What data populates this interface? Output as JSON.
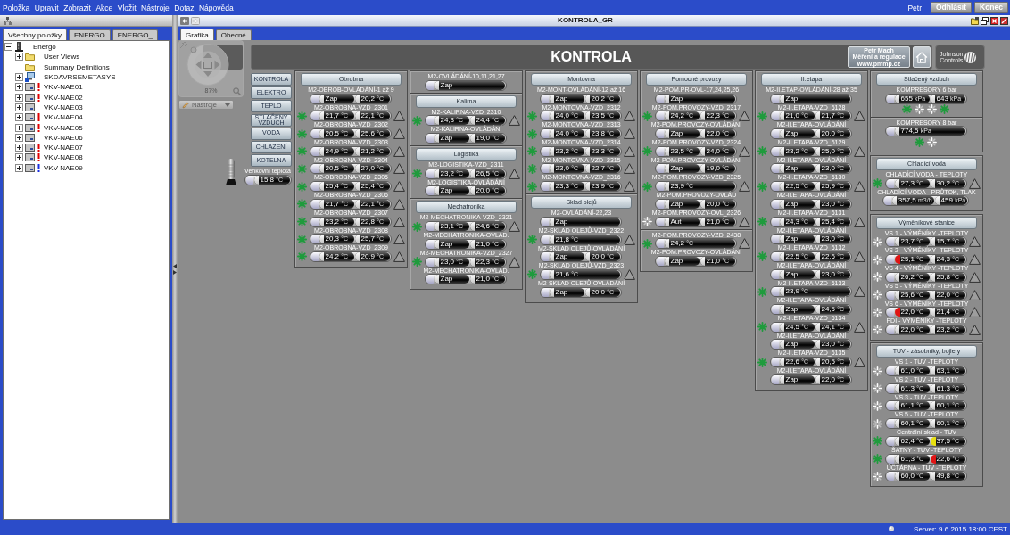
{
  "menu": [
    "Položka",
    "Upravit",
    "Zobrazit",
    "Akce",
    "Vložit",
    "Nástroje",
    "Dotaz",
    "Nápověda"
  ],
  "user": {
    "name": "Petr",
    "buttons": [
      "Odhlásit",
      "Konec"
    ]
  },
  "left_pane": {
    "tabs": [
      {
        "label": "Všechny položky",
        "selected": true
      },
      {
        "label": "ENERGO",
        "selected": false
      },
      {
        "label": "ENERGO_",
        "selected": false
      }
    ],
    "tree": [
      {
        "label": "Energo",
        "kind": "site",
        "expandable": true,
        "expanded": true,
        "alarm": false,
        "children": [
          {
            "label": "User Views",
            "kind": "folder",
            "expandable": true,
            "expanded": false,
            "alarm": false
          },
          {
            "label": "Summary Definitions",
            "kind": "folder",
            "expandable": false,
            "alarm": false
          },
          {
            "label": "SKDAVRSEMETASYS",
            "kind": "computer",
            "expandable": true,
            "expanded": false,
            "alarm": false
          },
          {
            "label": "VKV-NAE01",
            "kind": "controller",
            "expandable": true,
            "expanded": false,
            "alarm": true,
            "color": "#e00000"
          },
          {
            "label": "VKV-NAE02",
            "kind": "controller",
            "expandable": true,
            "expanded": false,
            "alarm": true,
            "color": "#e00000"
          },
          {
            "label": "VKV-NAE03",
            "kind": "controller",
            "expandable": true,
            "expanded": false,
            "alarm": false
          },
          {
            "label": "VKV-NAE04",
            "kind": "controller",
            "expandable": true,
            "expanded": false,
            "alarm": true,
            "color": "#e00000"
          },
          {
            "label": "VKV-NAE05",
            "kind": "controller",
            "expandable": true,
            "expanded": false,
            "alarm": true,
            "color": "#e00000"
          },
          {
            "label": "VKV-NAE06",
            "kind": "controller",
            "expandable": true,
            "expanded": false,
            "alarm": false
          },
          {
            "label": "VKV-NAE07",
            "kind": "controller",
            "expandable": true,
            "expanded": false,
            "alarm": true,
            "color": "#e00000"
          },
          {
            "label": "VKV-NAE08",
            "kind": "controller",
            "expandable": true,
            "expanded": false,
            "alarm": true,
            "color": "#e00000"
          },
          {
            "label": "VKV-NAE09",
            "kind": "controller",
            "expandable": true,
            "expanded": false,
            "alarm": true,
            "color": "#1a2ee0"
          }
        ]
      }
    ]
  },
  "window": {
    "title": "KONTROLA_GR",
    "tabs": [
      {
        "label": "Grafika",
        "selected": true
      },
      {
        "label": "Obecné",
        "selected": false
      }
    ]
  },
  "navigator": {
    "zoom": "87%",
    "tools": "Nástroje"
  },
  "banner": {
    "title": "KONTROLA",
    "company": [
      "Petr Mach",
      "Měření a regulace",
      "www.pmmp.cz"
    ],
    "logo": [
      "Johnson",
      "Controls"
    ]
  },
  "nav_buttons": [
    "KONTROLA",
    "ELEKTRO",
    "TEPLO",
    "STLAČENÝ VZDUCH",
    "VODA",
    "CHLAZENÍ",
    "KOTELNA"
  ],
  "outdoor": {
    "label": "Venkovní teplota",
    "values": [
      {
        "value": "15,8",
        "unit": "°C"
      }
    ]
  },
  "columns": [
    {
      "panels": [
        {
          "sections": [
            {
              "title": "Obrobna",
              "items": [
                {
                  "label": "M2-OBROB-OVLÁDÁNÍ-1 až 9",
                  "values": [
                    {
                      "value": "Zap"
                    },
                    {
                      "value": "20,2",
                      "unit": "°C"
                    }
                  ],
                  "warning": false
                },
                {
                  "label": "M2-OBROBNA-VZD_2301",
                  "fan": {
                    "running": true
                  },
                  "values": [
                    {
                      "value": "21,7",
                      "unit": "°C"
                    },
                    {
                      "value": "22,1",
                      "unit": "°C"
                    }
                  ],
                  "warning": true
                },
                {
                  "label": "M2-OBROBNA-VZD_2302",
                  "fan": {
                    "running": true
                  },
                  "values": [
                    {
                      "value": "20,5",
                      "unit": "°C"
                    },
                    {
                      "value": "25,6",
                      "unit": "°C"
                    }
                  ],
                  "warning": true
                },
                {
                  "label": "M2-OBROBNA-VZD_2303",
                  "fan": {
                    "running": true
                  },
                  "values": [
                    {
                      "value": "24,9",
                      "unit": "°C"
                    },
                    {
                      "value": "21,2",
                      "unit": "°C"
                    }
                  ],
                  "warning": true
                },
                {
                  "label": "M2-OBROBNA-VZD_2304",
                  "fan": {
                    "running": true
                  },
                  "values": [
                    {
                      "value": "20,5",
                      "unit": "°C"
                    },
                    {
                      "value": "27,0",
                      "unit": "°C"
                    }
                  ],
                  "warning": true
                },
                {
                  "label": "M2-OBROBNA-VZD_2305",
                  "fan": {
                    "running": true
                  },
                  "values": [
                    {
                      "value": "25,4",
                      "unit": "°C"
                    },
                    {
                      "value": "25,4",
                      "unit": "°C"
                    }
                  ],
                  "warning": true
                },
                {
                  "label": "M2-OBROBNA-VZD_2306",
                  "fan": {
                    "running": true
                  },
                  "values": [
                    {
                      "value": "21,7",
                      "unit": "°C"
                    },
                    {
                      "value": "22,1",
                      "unit": "°C"
                    }
                  ],
                  "warning": true
                },
                {
                  "label": "M2-OBROBNA-VZD_2307",
                  "fan": {
                    "running": true
                  },
                  "values": [
                    {
                      "value": "23,2",
                      "unit": "°C"
                    },
                    {
                      "value": "22,8",
                      "unit": "°C"
                    }
                  ],
                  "warning": true
                },
                {
                  "label": "M2-OBROBNA-VZD_2308",
                  "fan": {
                    "running": true
                  },
                  "values": [
                    {
                      "value": "20,3",
                      "unit": "°C"
                    },
                    {
                      "value": "25,7",
                      "unit": "°C"
                    }
                  ],
                  "warning": true
                },
                {
                  "label": "M2-OBROBNA-VZD_2309",
                  "fan": {
                    "running": true
                  },
                  "values": [
                    {
                      "value": "24,2",
                      "unit": "°C"
                    },
                    {
                      "value": "20,9",
                      "unit": "°C"
                    }
                  ],
                  "warning": true
                }
              ]
            }
          ]
        }
      ]
    },
    {
      "panels": [
        {
          "sections": [
            {
              "items": [
                {
                  "label": "M2-OVLÁDÁNÍ-10,11,21,27",
                  "values": [
                    {
                      "value": "Zap"
                    }
                  ],
                  "warning": false
                }
              ]
            },
            {
              "title": "Kalirna",
              "items": [
                {
                  "label": "M2-KALIRNA-VZD_2310",
                  "fan": {
                    "running": true
                  },
                  "values": [
                    {
                      "value": "24,3",
                      "unit": "°C"
                    },
                    {
                      "value": "24,4",
                      "unit": "°C"
                    }
                  ],
                  "warning": true
                },
                {
                  "label": "M2-KALIRNA-OVLÁDÁNÍ",
                  "values": [
                    {
                      "value": "Zap"
                    },
                    {
                      "value": "19,0",
                      "unit": "°C"
                    }
                  ],
                  "warning": false
                }
              ]
            },
            {
              "title": "Logistika",
              "items": [
                {
                  "label": "M2-LOGISTIKA-VZD_2311",
                  "fan": {
                    "running": true
                  },
                  "values": [
                    {
                      "value": "23,2",
                      "unit": "°C"
                    },
                    {
                      "value": "26,5",
                      "unit": "°C"
                    }
                  ],
                  "warning": true
                },
                {
                  "label": "M2-LOGISTIKA-OVLÁDÁNÍ",
                  "values": [
                    {
                      "value": "Zap"
                    },
                    {
                      "value": "20,0",
                      "unit": "°C"
                    }
                  ],
                  "warning": false
                }
              ]
            },
            {
              "title": "Mechatronika",
              "items": [
                {
                  "label": "M2-MECHATRONIKA-VZD_2321",
                  "fan": {
                    "running": true
                  },
                  "values": [
                    {
                      "value": "23,1",
                      "unit": "°C"
                    },
                    {
                      "value": "24,6",
                      "unit": "°C"
                    }
                  ],
                  "warning": true
                },
                {
                  "label": "M2-MECHATRONIKA-OVLÁD.",
                  "values": [
                    {
                      "value": "Zap"
                    },
                    {
                      "value": "21,0",
                      "unit": "°C"
                    }
                  ],
                  "warning": false
                },
                {
                  "label": "M2-MECHATRONIKA-VZD_2327",
                  "fan": {
                    "running": true
                  },
                  "values": [
                    {
                      "value": "23,0",
                      "unit": "°C"
                    },
                    {
                      "value": "22,3",
                      "unit": "°C"
                    }
                  ],
                  "warning": true
                },
                {
                  "label": "M2-MECHATRONIKA-OVLÁD.",
                  "values": [
                    {
                      "value": "Zap"
                    },
                    {
                      "value": "21,0",
                      "unit": "°C"
                    }
                  ],
                  "warning": false
                }
              ]
            }
          ]
        }
      ]
    },
    {
      "panels": [
        {
          "sections": [
            {
              "title": "Montovna",
              "items": [
                {
                  "label": "M2-MONT-OVLÁDÁNÍ-12 až 16",
                  "values": [
                    {
                      "value": "Zap"
                    },
                    {
                      "value": "20,2",
                      "unit": "°C"
                    }
                  ],
                  "warning": false
                },
                {
                  "label": "M2-MONTOVNA-VZD_2312",
                  "fan": {
                    "running": true
                  },
                  "values": [
                    {
                      "value": "24,0",
                      "unit": "°C"
                    },
                    {
                      "value": "23,5",
                      "unit": "°C"
                    }
                  ],
                  "warning": true
                },
                {
                  "label": "M2-MONTOVNA-VZD_2313",
                  "fan": {
                    "running": true
                  },
                  "values": [
                    {
                      "value": "24,0",
                      "unit": "°C"
                    },
                    {
                      "value": "23,8",
                      "unit": "°C"
                    }
                  ],
                  "warning": true
                },
                {
                  "label": "M2-MONTOVNA-VZD_2314",
                  "fan": {
                    "running": true
                  },
                  "values": [
                    {
                      "value": "23,2",
                      "unit": "°C"
                    },
                    {
                      "value": "23,3",
                      "unit": "°C"
                    }
                  ],
                  "warning": true
                },
                {
                  "label": "M2-MONTOVNA-VZD_2315",
                  "fan": {
                    "running": true
                  },
                  "values": [
                    {
                      "value": "23,0",
                      "unit": "°C"
                    },
                    {
                      "value": "22,7",
                      "unit": "°C"
                    }
                  ],
                  "warning": true
                },
                {
                  "label": "M2-MONTOVNA-VZD_2316",
                  "fan": {
                    "running": true
                  },
                  "values": [
                    {
                      "value": "23,3",
                      "unit": "°C"
                    },
                    {
                      "value": "23,9",
                      "unit": "°C"
                    }
                  ],
                  "warning": true
                }
              ]
            },
            {
              "title": "Sklad olejů",
              "items": [
                {
                  "label": "M2-OVLÁDÁNÍ-22,23",
                  "values": [
                    {
                      "value": "Zap"
                    }
                  ],
                  "warning": false
                },
                {
                  "label": "M2-SKLAD OLEJŮ-VZD_2322",
                  "fan": {
                    "running": true
                  },
                  "values": [
                    {
                      "value": "21,8",
                      "unit": "°C"
                    }
                  ],
                  "warning": true
                },
                {
                  "label": "M2-SKLAD OLEJŮ-OVLÁDÁNÍ",
                  "values": [
                    {
                      "value": "Zap"
                    },
                    {
                      "value": "20,0",
                      "unit": "°C"
                    }
                  ],
                  "warning": false
                },
                {
                  "label": "M2-SKLAD OLEJŮ-VZD_2323",
                  "fan": {
                    "running": true
                  },
                  "values": [
                    {
                      "value": "21,6",
                      "unit": "°C"
                    }
                  ],
                  "warning": true
                },
                {
                  "label": "M2-SKLAD OLEJŮ-OVLÁDÁNÍ",
                  "values": [
                    {
                      "value": "Zap"
                    },
                    {
                      "value": "20,0",
                      "unit": "°C"
                    }
                  ],
                  "warning": false
                }
              ]
            }
          ]
        }
      ]
    },
    {
      "panels": [
        {
          "sections": [
            {
              "title": "Pomocné provozy",
              "items": [
                {
                  "label": "M2-POM.PR-OVL-17,24,25,26",
                  "values": [
                    {
                      "value": "Zap"
                    }
                  ],
                  "warning": false
                },
                {
                  "label": "M2-POM.PROVOZY-VZD_2317",
                  "fan": {
                    "running": true
                  },
                  "values": [
                    {
                      "value": "24,2",
                      "unit": "°C"
                    },
                    {
                      "value": "22,3",
                      "unit": "°C"
                    }
                  ],
                  "warning": true
                },
                {
                  "label": "M2-POM.PROVOZY-OVLÁDÁNÍ",
                  "values": [
                    {
                      "value": "Zap"
                    },
                    {
                      "value": "22,0",
                      "unit": "°C"
                    }
                  ],
                  "warning": false
                },
                {
                  "label": "M2-POM.PROVOZY-VZD_2324",
                  "fan": {
                    "running": true
                  },
                  "values": [
                    {
                      "value": "23,5",
                      "unit": "°C"
                    },
                    {
                      "value": "24,0",
                      "unit": "°C"
                    }
                  ],
                  "warning": true
                },
                {
                  "label": "M2-POM.PROVOZY-OVLÁDÁNÍ",
                  "values": [
                    {
                      "value": "Zap"
                    },
                    {
                      "value": "19,0",
                      "unit": "°C"
                    }
                  ],
                  "warning": false
                },
                {
                  "label": "M2-POM.PROVOZY-VZD_2325",
                  "fan": {
                    "running": true
                  },
                  "values": [
                    {
                      "value": "23,9",
                      "unit": "°C"
                    }
                  ],
                  "warning": true
                },
                {
                  "label": "M2-POM.PROVOZY-OVLÁD",
                  "values": [
                    {
                      "value": "Zap"
                    },
                    {
                      "value": "20,0",
                      "unit": "°C"
                    }
                  ],
                  "warning": false
                },
                {
                  "label": "M2-POM.PROVOZY-OVL_2326",
                  "fan": {
                    "running": false
                  },
                  "values": [
                    {
                      "value": "Aut"
                    },
                    {
                      "value": "21,0",
                      "unit": "°C"
                    }
                  ],
                  "warning": true
                }
              ]
            },
            {
              "items": [
                {
                  "label": "M2-POM.PROVOZY-VZD_2438",
                  "fan": {
                    "running": true
                  },
                  "values": [
                    {
                      "value": "24,2",
                      "unit": "°C"
                    }
                  ],
                  "warning": true
                },
                {
                  "label": "M2-POM.PROVOZY-OVLÁDÁNÍ",
                  "values": [
                    {
                      "value": "Zap"
                    },
                    {
                      "value": "21,0",
                      "unit": "°C"
                    }
                  ],
                  "warning": false
                }
              ]
            }
          ]
        }
      ]
    },
    {
      "panels": [
        {
          "sections": [
            {
              "title": "II.etapa",
              "items": [
                {
                  "label": "M2-II.ETAP-OVLÁDÁNÍ-28 až 35",
                  "values": [
                    {
                      "value": "Zap"
                    }
                  ],
                  "warning": false
                },
                {
                  "label": "M2-II.ETAPA-VZD_6128",
                  "fan": {
                    "running": true
                  },
                  "values": [
                    {
                      "value": "21,0",
                      "unit": "°C"
                    },
                    {
                      "value": "21,7",
                      "unit": "°C"
                    }
                  ],
                  "warning": true
                },
                {
                  "label": "M2-II.ETAPA-OVLÁDÁNÍ",
                  "values": [
                    {
                      "value": "Zap"
                    },
                    {
                      "value": "20,0",
                      "unit": "°C"
                    }
                  ],
                  "warning": false
                },
                {
                  "label": "M2-II.ETAPA-VZD_6129",
                  "fan": {
                    "running": true
                  },
                  "values": [
                    {
                      "value": "23,2",
                      "unit": "°C"
                    },
                    {
                      "value": "25,0",
                      "unit": "°C"
                    }
                  ],
                  "warning": true
                },
                {
                  "label": "M2-II.ETAPA-OVLÁDÁNÍ",
                  "values": [
                    {
                      "value": "Zap"
                    },
                    {
                      "value": "23,0",
                      "unit": "°C"
                    }
                  ],
                  "warning": false
                },
                {
                  "label": "M2-II.ETAPA-VZD_6130",
                  "fan": {
                    "running": true
                  },
                  "values": [
                    {
                      "value": "22,5",
                      "unit": "°C"
                    },
                    {
                      "value": "25,9",
                      "unit": "°C"
                    }
                  ],
                  "warning": true
                },
                {
                  "label": "M2-II.ETAPA-OVLÁDÁNÍ",
                  "values": [
                    {
                      "value": "Zap"
                    },
                    {
                      "value": "23,0",
                      "unit": "°C"
                    }
                  ],
                  "warning": false
                },
                {
                  "label": "M2-II.ETAPA-VZD_6131",
                  "fan": {
                    "running": true
                  },
                  "values": [
                    {
                      "value": "24,3",
                      "unit": "°C"
                    },
                    {
                      "value": "25,4",
                      "unit": "°C"
                    }
                  ],
                  "warning": true
                },
                {
                  "label": "M2-II.ETAPA-OVLÁDÁNÍ",
                  "values": [
                    {
                      "value": "Zap"
                    },
                    {
                      "value": "23,0",
                      "unit": "°C"
                    }
                  ],
                  "warning": false
                },
                {
                  "label": "M2-II.ETAPA-VZD_6132",
                  "fan": {
                    "running": true
                  },
                  "values": [
                    {
                      "value": "22,5",
                      "unit": "°C"
                    },
                    {
                      "value": "22,6",
                      "unit": "°C"
                    }
                  ],
                  "warning": true
                },
                {
                  "label": "M2-II.ETAPA-OVLÁDÁNÍ",
                  "values": [
                    {
                      "value": "Zap"
                    },
                    {
                      "value": "23,0",
                      "unit": "°C"
                    }
                  ],
                  "warning": false
                },
                {
                  "label": "M2-II.ETAPA-VZD_6133",
                  "fan": {
                    "running": true
                  },
                  "values": [
                    {
                      "value": "23,9",
                      "unit": "°C"
                    }
                  ],
                  "warning": true
                },
                {
                  "label": "M2-II.ETAPA-OVLÁDÁNÍ",
                  "values": [
                    {
                      "value": "Zap"
                    },
                    {
                      "value": "24,5",
                      "unit": "°C"
                    }
                  ],
                  "warning": false
                },
                {
                  "label": "M2-II.ETAPA-VZD_6134",
                  "fan": {
                    "running": true
                  },
                  "values": [
                    {
                      "value": "24,5",
                      "unit": "°C"
                    },
                    {
                      "value": "24,1",
                      "unit": "°C"
                    }
                  ],
                  "warning": true
                },
                {
                  "label": "M2-II.ETAPA-OVLÁDÁNÍ",
                  "values": [
                    {
                      "value": "Zap"
                    },
                    {
                      "value": "23,0",
                      "unit": "°C"
                    }
                  ],
                  "warning": false
                },
                {
                  "label": "M2-II.ETAPA-VZD_6135",
                  "fan": {
                    "running": true
                  },
                  "values": [
                    {
                      "value": "22,6",
                      "unit": "°C"
                    },
                    {
                      "value": "20,5",
                      "unit": "°C"
                    }
                  ],
                  "warning": true
                },
                {
                  "label": "M2-II.ETAPA-OVLÁDÁNÍ",
                  "values": [
                    {
                      "value": "Zap"
                    },
                    {
                      "value": "22,0",
                      "unit": "°C"
                    }
                  ],
                  "warning": false
                }
              ]
            }
          ]
        }
      ]
    },
    {
      "panels": [
        {
          "sections": [
            {
              "title": "Stlačený vzduch",
              "items": [
                {
                  "label": "KOMPRESORY 6 bar",
                  "values": [
                    {
                      "value": "655",
                      "unit": "kPa"
                    },
                    {
                      "value": "643",
                      "unit": "kPa"
                    }
                  ],
                  "warning": false,
                  "fan_row": [
                    {
                      "running": true
                    },
                    {
                      "running": false
                    },
                    {
                      "running": false
                    },
                    {
                      "running": true
                    }
                  ]
                }
              ]
            },
            {
              "items": [
                {
                  "label": "KOMPRESORY 8 bar",
                  "values": [
                    {
                      "value": "774,5",
                      "unit": "kPa"
                    }
                  ],
                  "warning": false,
                  "fan_row": [
                    {
                      "running": true
                    },
                    {
                      "running": false
                    }
                  ]
                }
              ]
            }
          ]
        },
        {
          "sections": [
            {
              "title": "Chladící voda",
              "items": [
                {
                  "label": "CHLADÍCÍ VODA - TEPLOTY",
                  "fan": {
                    "running": true
                  },
                  "values": [
                    {
                      "value": "27,3",
                      "unit": "°C"
                    },
                    {
                      "value": "30,2",
                      "unit": "°C"
                    }
                  ],
                  "warning": true
                },
                {
                  "label": "CHLADÍCÍ VODA - PRŮTOK, TLAK",
                  "values": [
                    {
                      "value": "357,5",
                      "unit": "m3/h"
                    },
                    {
                      "value": "459",
                      "unit": "kPa"
                    }
                  ],
                  "warning": false
                }
              ]
            }
          ]
        },
        {
          "sections": [
            {
              "title": "Výměníkové stanice",
              "items": [
                {
                  "label": "VS 1 - VÝMĚNÍKY -TEPLOTY",
                  "fan": {
                    "running": false
                  },
                  "values": [
                    {
                      "value": "23,7",
                      "unit": "°C"
                    },
                    {
                      "value": "15,7",
                      "unit": "°C"
                    }
                  ],
                  "warning": true
                },
                {
                  "label": "VS 2 - VÝMĚNÍKY -TEPLOTY",
                  "fan": {
                    "running": false
                  },
                  "values": [
                    {
                      "value": "25,1",
                      "unit": "°C",
                      "color": "#e01414"
                    },
                    {
                      "value": "24,3",
                      "unit": "°C"
                    }
                  ],
                  "warning": true
                },
                {
                  "label": "VS 4 - VÝMĚNÍKY -TEPLOTY",
                  "fan": {
                    "running": false
                  },
                  "values": [
                    {
                      "value": "26,2",
                      "unit": "°C"
                    },
                    {
                      "value": "25,8",
                      "unit": "°C"
                    }
                  ],
                  "warning": true
                },
                {
                  "label": "VS 5 - VÝMĚNÍKY -TEPLOTY",
                  "fan": {
                    "running": false
                  },
                  "values": [
                    {
                      "value": "25,6",
                      "unit": "°C"
                    },
                    {
                      "value": "22,0",
                      "unit": "°C"
                    }
                  ],
                  "warning": true
                },
                {
                  "label": "VS 6 - VÝMĚNÍKY -TEPLOTY",
                  "fan": {
                    "running": false
                  },
                  "values": [
                    {
                      "value": "22,0",
                      "unit": "°C",
                      "color": "#e01414"
                    },
                    {
                      "value": "21,4",
                      "unit": "°C"
                    }
                  ],
                  "warning": true
                },
                {
                  "label": "PDI - VÝMĚNÍKY -TEPLOTY",
                  "fan": {
                    "running": false
                  },
                  "values": [
                    {
                      "value": "22,0",
                      "unit": "°C"
                    },
                    {
                      "value": "23,2",
                      "unit": "°C"
                    }
                  ],
                  "warning": true
                }
              ]
            }
          ]
        },
        {
          "sections": [
            {
              "title": "TUV - zásobníky, bojlery",
              "items": [
                {
                  "label": "VS 1 - TUV -TEPLOTY",
                  "fan": {
                    "running": false
                  },
                  "values": [
                    {
                      "value": "61,0",
                      "unit": "°C"
                    },
                    {
                      "value": "63,1",
                      "unit": "°C"
                    }
                  ],
                  "warning": false
                },
                {
                  "label": "VS 2 - TUV -TEPLOTY",
                  "fan": {
                    "running": false
                  },
                  "values": [
                    {
                      "value": "61,3",
                      "unit": "°C"
                    },
                    {
                      "value": "61,3",
                      "unit": "°C"
                    }
                  ],
                  "warning": false
                },
                {
                  "label": "VS 3 - TUV -TEPLOTY",
                  "fan": {
                    "running": false
                  },
                  "values": [
                    {
                      "value": "61,1",
                      "unit": "°C"
                    },
                    {
                      "value": "60,1",
                      "unit": "°C"
                    }
                  ],
                  "warning": false
                },
                {
                  "label": "VS 5 - TUV -TEPLOTY",
                  "fan": {
                    "running": false
                  },
                  "values": [
                    {
                      "value": "60,1",
                      "unit": "°C"
                    },
                    {
                      "value": "60,1",
                      "unit": "°C"
                    }
                  ],
                  "warning": false
                },
                {
                  "label": "Centrální sklad - TUV",
                  "fan": {
                    "running": true
                  },
                  "values": [
                    {
                      "value": "62,4",
                      "unit": "°C"
                    },
                    {
                      "value": "37,5",
                      "unit": "°C",
                      "color": "#e8e010"
                    }
                  ],
                  "warning": false
                },
                {
                  "label": "ŠATNY - TUV -TEPLOTY",
                  "fan": {
                    "running": true
                  },
                  "values": [
                    {
                      "value": "61,3",
                      "unit": "°C"
                    },
                    {
                      "value": "22,6",
                      "unit": "°C",
                      "color": "#e01414"
                    }
                  ],
                  "warning": false
                },
                {
                  "label": "ÚČTÁRNA - TUV -TEPLOTY",
                  "fan": {
                    "running": false
                  },
                  "values": [
                    {
                      "value": "60,0",
                      "unit": "°C"
                    },
                    {
                      "value": "49,8",
                      "unit": "°C"
                    }
                  ],
                  "warning": false
                }
              ]
            }
          ]
        }
      ]
    }
  ],
  "status_bar": {
    "text": "Server: 9.6.2015 18:00 CEST"
  }
}
